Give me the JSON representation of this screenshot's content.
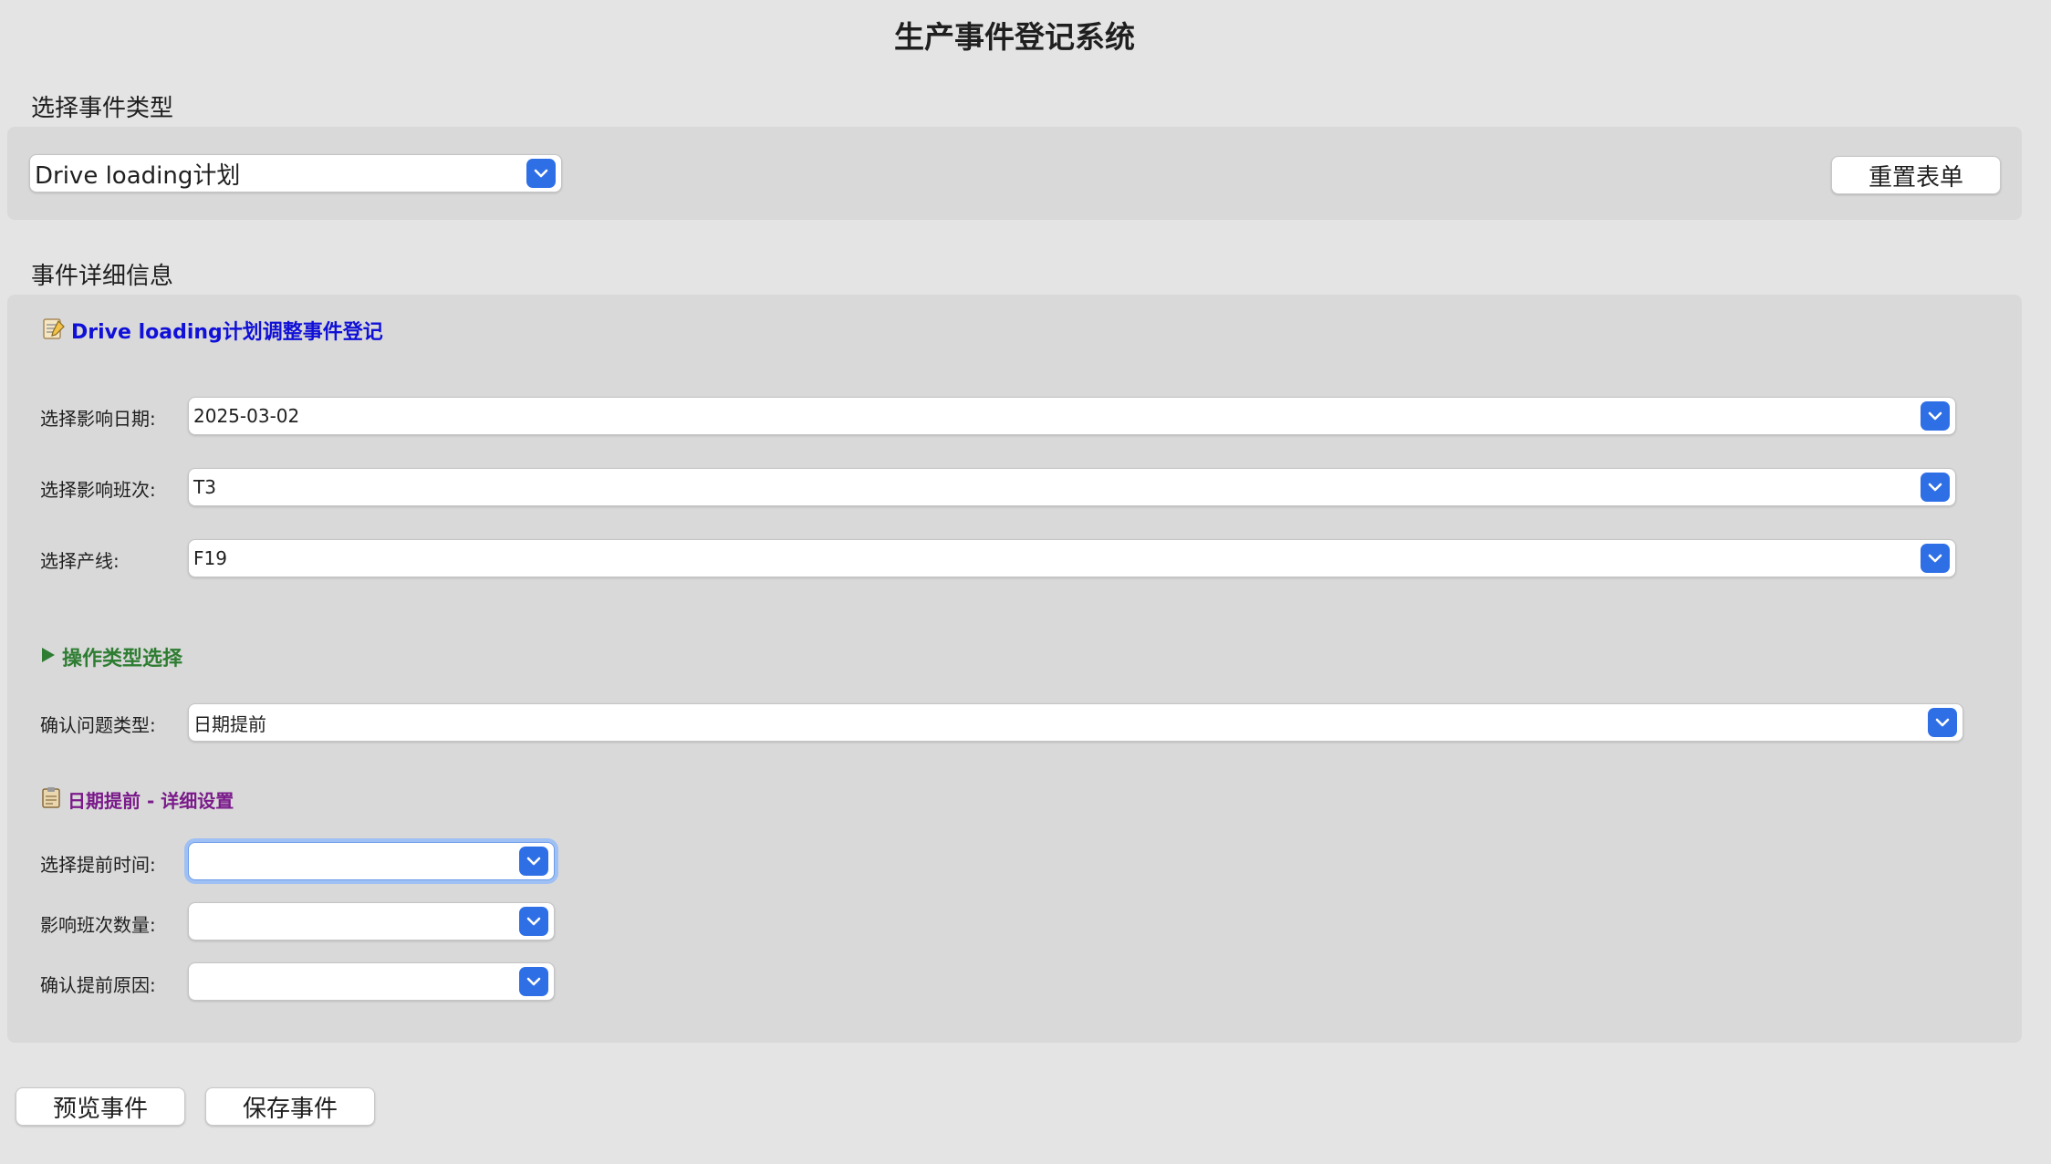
{
  "app": {
    "title": "生产事件登记系统"
  },
  "event_type_section": {
    "label": "选择事件类型",
    "selected": "Drive loading计划",
    "reset_button": "重置表单"
  },
  "details_section": {
    "label": "事件详细信息",
    "heading": "Drive loading计划调整事件登记",
    "fields": [
      {
        "label": "选择影响日期:",
        "value": "2025-03-02"
      },
      {
        "label": "选择影响班次:",
        "value": "T3"
      },
      {
        "label": "选择产线:",
        "value": "F19"
      }
    ],
    "operation": {
      "heading": "操作类型选择",
      "label": "确认问题类型:",
      "value": "日期提前"
    },
    "advance": {
      "heading": "日期提前 - 详细设置",
      "fields": [
        {
          "label": "选择提前时间:",
          "value": ""
        },
        {
          "label": "影响班次数量:",
          "value": ""
        },
        {
          "label": "确认提前原因:",
          "value": ""
        }
      ]
    }
  },
  "actions": {
    "preview_button": "预览事件",
    "save_button": "保存事件"
  },
  "icons": {
    "dropdown": "chevron-down-icon",
    "memo": "memo-icon",
    "triangle": "play-triangle-icon",
    "clipboard": "clipboard-icon"
  },
  "colors": {
    "accent": "#2f6fe6",
    "heading_blue": "#1010d8",
    "heading_green": "#2e7d32",
    "heading_purple": "#7a1a8a"
  }
}
